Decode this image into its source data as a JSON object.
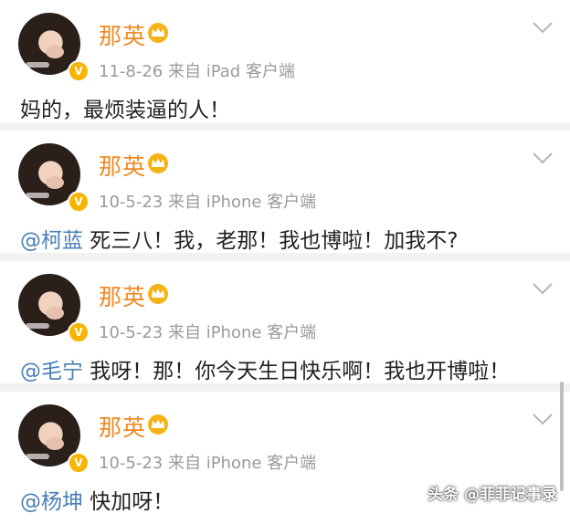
{
  "posts": [
    {
      "username": "那英",
      "meta": "11-8-26  来自 iPad 客户端",
      "mention": "",
      "text": "妈的，最烦装逼的人！"
    },
    {
      "username": "那英",
      "meta": "10-5-23  来自 iPhone 客户端",
      "mention": "@柯蓝",
      "text": " 死三八！我，老那！我也博啦！加我不?"
    },
    {
      "username": "那英",
      "meta": "10-5-23  来自 iPhone 客户端",
      "mention": "@毛宁",
      "text": " 我呀！那！你今天生日快乐啊！我也开博啦！"
    },
    {
      "username": "那英",
      "meta": "10-5-23  来自 iPhone 客户端",
      "mention": "@杨坤",
      "text": " 快加呀！"
    }
  ],
  "footer": {
    "watermark": "头条 @菲菲记事录"
  },
  "icons": {
    "verified": "verified-v-icon",
    "crown": "crown-icon",
    "chevron": "chevron-down-icon"
  },
  "colors": {
    "username": "#f08a24",
    "mention": "#4a7fb5",
    "meta": "#9a9a9a",
    "badge": "#f7b500"
  }
}
